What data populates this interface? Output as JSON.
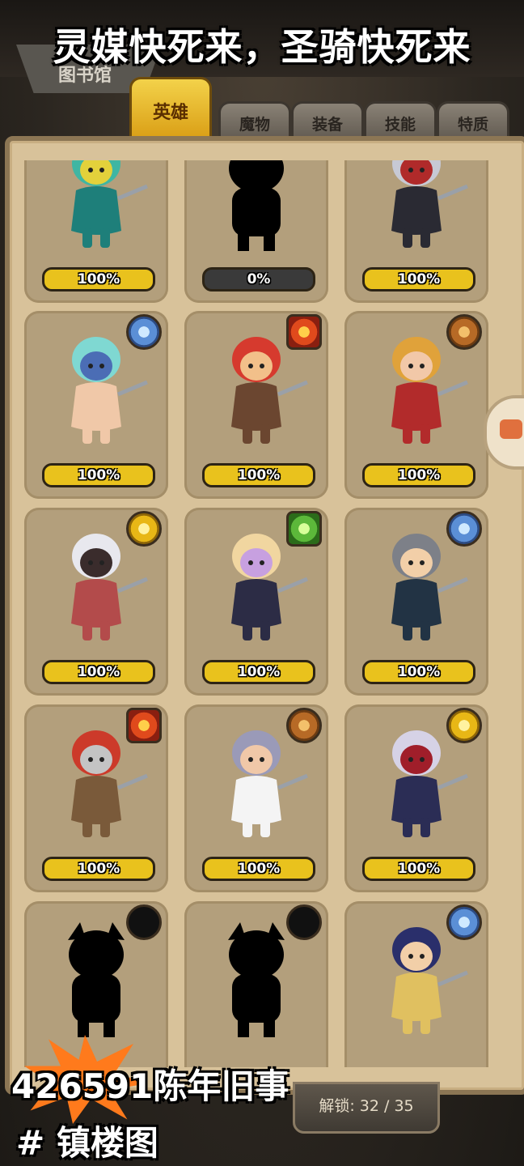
{
  "overlay": {
    "title": "灵媒快死来，圣骑快死来",
    "id_line": "426591陈年旧事",
    "tag_line": "# 镇楼图"
  },
  "header": {
    "library_label": "图书馆"
  },
  "tabs": [
    {
      "label": "英雄",
      "active": true
    },
    {
      "label": "魔物",
      "active": false
    },
    {
      "label": "装备",
      "active": false
    },
    {
      "label": "技能",
      "active": false
    },
    {
      "label": "特质",
      "active": false
    }
  ],
  "cards": [
    {
      "progress": "100%",
      "element": "nature",
      "character": "teal-phoenix",
      "silhouette": false
    },
    {
      "progress": "0%",
      "element": "dark",
      "character": "locked-beast",
      "silhouette": true
    },
    {
      "progress": "100%",
      "element": "nature",
      "character": "silver-knight",
      "silhouette": false
    },
    {
      "progress": "100%",
      "element": "water",
      "character": "elf-girl",
      "silhouette": false
    },
    {
      "progress": "100%",
      "element": "fire",
      "character": "red-swordsman",
      "silhouette": false
    },
    {
      "progress": "100%",
      "element": "earth",
      "character": "gunner-girl",
      "silhouette": false
    },
    {
      "progress": "100%",
      "element": "light",
      "character": "white-hair-demon",
      "silhouette": false
    },
    {
      "progress": "100%",
      "element": "nature",
      "character": "fox-girl",
      "silhouette": false
    },
    {
      "progress": "100%",
      "element": "water",
      "character": "grey-swordsman",
      "silhouette": false
    },
    {
      "progress": "100%",
      "element": "fire",
      "character": "spear-warrior",
      "silhouette": false
    },
    {
      "progress": "100%",
      "element": "earth",
      "character": "doctor-girl",
      "silhouette": false
    },
    {
      "progress": "100%",
      "element": "light",
      "character": "twin-tail-girl",
      "silhouette": false
    },
    {
      "progress": "",
      "element": "dark",
      "character": "locked-ogre",
      "silhouette": true
    },
    {
      "progress": "",
      "element": "dark",
      "character": "locked-horned",
      "silhouette": true
    },
    {
      "progress": "",
      "element": "water",
      "character": "magician-boy",
      "silhouette": false
    }
  ],
  "footer": {
    "unlock_label": "解锁: 32 / 35"
  },
  "colors": {
    "panel": "#d8c29a",
    "card": "#b39f7c",
    "progress_fill": "#e9c21d",
    "tab_active": "#f3d24a"
  }
}
